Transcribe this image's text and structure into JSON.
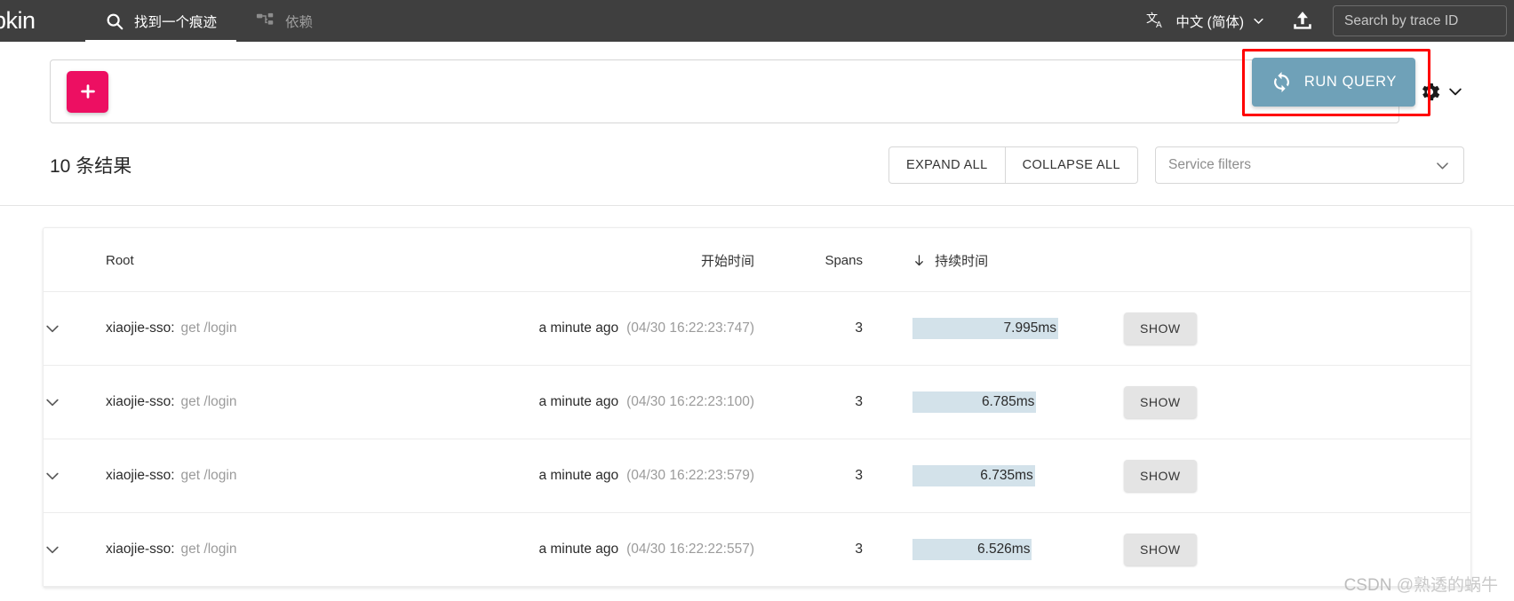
{
  "navbar": {
    "brand": "pkin",
    "tabs": [
      {
        "label": "找到一个痕迹",
        "icon": "search-icon",
        "active": true
      },
      {
        "label": "依赖",
        "icon": "dependency-tree-icon",
        "active": false
      }
    ],
    "language": {
      "label": "中文 (简体)",
      "icon": "translate-icon",
      "chevron": "chevron-down-icon"
    },
    "upload_icon": "upload-icon",
    "trace_search_placeholder": "Search by trace ID"
  },
  "query_bar": {
    "add_label": "+",
    "run_query_label": "RUN QUERY",
    "run_query_icon": "refresh-icon",
    "settings_icon": "gear-icon",
    "settings_chevron": "chevron-down-icon",
    "highlight_color": "#ff0000",
    "run_query_color": "#6fa1b8",
    "add_button_color": "#ed0f62"
  },
  "results_bar": {
    "count_label": "10 条结果",
    "expand_all": "EXPAND ALL",
    "collapse_all": "COLLAPSE ALL",
    "service_filters_placeholder": "Service filters",
    "service_filters_chevron": "chevron-down-icon"
  },
  "table": {
    "headers": {
      "root": "Root",
      "start_time": "开始时间",
      "spans": "Spans",
      "duration": "持续时间",
      "duration_sort_icon": "arrow-down-icon"
    },
    "rows": [
      {
        "toggle_icon": "chevron-down-icon",
        "service": "xiaojie-sso:",
        "operation": "get /login",
        "relative_time": "a minute ago",
        "absolute_time": "(04/30 16:22:23:747)",
        "spans": "3",
        "duration": "7.995ms",
        "duration_pct": 100,
        "show_label": "SHOW"
      },
      {
        "toggle_icon": "chevron-down-icon",
        "service": "xiaojie-sso:",
        "operation": "get /login",
        "relative_time": "a minute ago",
        "absolute_time": "(04/30 16:22:23:100)",
        "spans": "3",
        "duration": "6.785ms",
        "duration_pct": 85,
        "show_label": "SHOW"
      },
      {
        "toggle_icon": "chevron-down-icon",
        "service": "xiaojie-sso:",
        "operation": "get /login",
        "relative_time": "a minute ago",
        "absolute_time": "(04/30 16:22:23:579)",
        "spans": "3",
        "duration": "6.735ms",
        "duration_pct": 84,
        "show_label": "SHOW"
      },
      {
        "toggle_icon": "chevron-down-icon",
        "service": "xiaojie-sso:",
        "operation": "get /login",
        "relative_time": "a minute ago",
        "absolute_time": "(04/30 16:22:22:557)",
        "spans": "3",
        "duration": "6.526ms",
        "duration_pct": 82,
        "show_label": "SHOW"
      }
    ]
  },
  "watermark": {
    "site": "CSDN ",
    "user": "@熟透的蜗牛"
  }
}
